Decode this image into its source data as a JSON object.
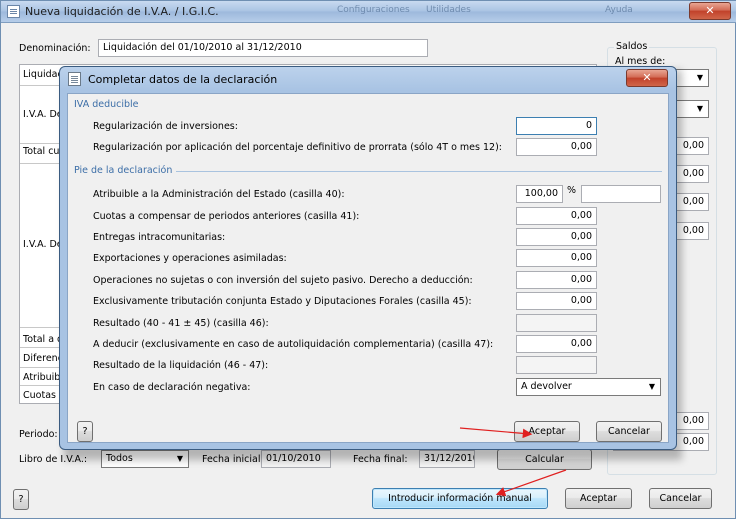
{
  "window": {
    "title": "Nueva liquidación de I.V.A. / I.G.I.C.",
    "close_glyph": "✕",
    "faded_titles": [
      "Configuraciones",
      "Utilidades",
      "Ayuda"
    ]
  },
  "main": {
    "denominacion_label": "Denominación:",
    "denominacion_value": "Liquidación del 01/10/2010 al 31/12/2010",
    "left_labels": {
      "liquidac": "Liquidac",
      "iva_de_top": "I.V.A. De",
      "total_cu": "Total cu",
      "iva_de_mid": "I.V.A. De",
      "total_a_d": "Total a d",
      "diferenc": "Diferenc",
      "atribuib": "Atribuib",
      "cuotas_a": "Cuotas a"
    },
    "saldos": {
      "title": "Saldos",
      "al_mes_de": "Al mes de:",
      "values": [
        "0,00",
        "0,00",
        "0,00",
        "0,00",
        "0,00",
        "0,00"
      ]
    },
    "periodo_label": "Periodo:",
    "libro_label": "Libro de I.V.A.:",
    "libro_value": "Todos",
    "fecha_inicial_label": "Fecha inicial:",
    "fecha_inicial_value": "01/10/2010",
    "fecha_final_label": "Fecha final:",
    "fecha_final_value": "31/12/2010",
    "calcular_button": "Calcular",
    "help_button": "?",
    "manual_button": "Introducir información manual",
    "aceptar_button": "Aceptar",
    "cancelar_button": "Cancelar"
  },
  "dialog": {
    "title": "Completar datos de la declaración",
    "close_glyph": "✕",
    "section_iva": "IVA deducible",
    "section_pie": "Pie de la declaración",
    "rows": [
      {
        "label": "Regularización de inversiones:",
        "value": "0"
      },
      {
        "label": "Regularización por aplicación del porcentaje definitivo de prorrata (sólo 4T o mes 12):",
        "value": "0,00"
      },
      {
        "label": "Atribuible a la Administración del Estado (casilla 40):",
        "value": "100,00",
        "unit": "%"
      },
      {
        "label": "Cuotas a compensar de periodos anteriores (casilla 41):",
        "value": "0,00"
      },
      {
        "label": "Entregas intracomunitarias:",
        "value": "0,00"
      },
      {
        "label": "Exportaciones y operaciones asimiladas:",
        "value": "0,00"
      },
      {
        "label": "Operaciones no sujetas o con inversión del sujeto pasivo. Derecho a deducción:",
        "value": "0,00"
      },
      {
        "label": "Exclusivamente tributación conjunta Estado y Diputaciones Forales (casilla 45):",
        "value": "0,00"
      },
      {
        "label": "Resultado (40 - 41 ± 45) (casilla 46):",
        "value": ""
      },
      {
        "label": "A deducir (exclusivamente en caso de autoliquidación complementaria) (casilla 47):",
        "value": "0,00"
      },
      {
        "label": "Resultado de la liquidación (46 - 47):",
        "value": ""
      },
      {
        "label": "En caso de declaración negativa:",
        "value": "A devolver"
      }
    ],
    "help_button": "?",
    "aceptar_button": "Aceptar",
    "cancelar_button": "Cancelar"
  },
  "colors": {
    "annotation_arrow": "#e02020",
    "section_text": "#3c6ea7"
  }
}
